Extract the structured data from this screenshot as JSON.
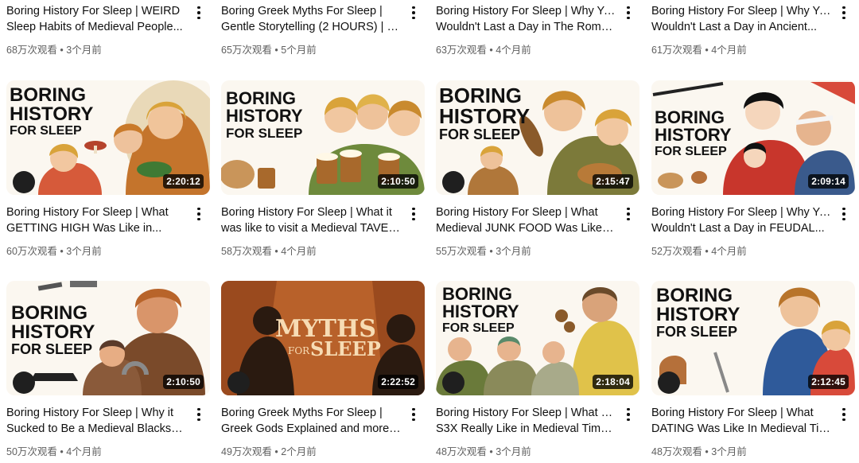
{
  "videos": [
    {
      "title_l1": "Boring History For Sleep | WEIRD",
      "title_l2": "Sleep Habits of Medieval People...",
      "views": "68万次观看",
      "age": "3个月前"
    },
    {
      "title_l1": "Boring Greek Myths For Sleep |",
      "title_l2": "Gentle Storytelling (2 HOURS) | 3...",
      "views": "65万次观看",
      "age": "5个月前"
    },
    {
      "title_l1": "Boring History For Sleep | Why You",
      "title_l2": "Wouldn't Last a Day in The Roman...",
      "views": "63万次观看",
      "age": "4个月前"
    },
    {
      "title_l1": "Boring History For Sleep | Why You",
      "title_l2": "Wouldn't Last a Day in Ancient...",
      "views": "61万次观看",
      "age": "4个月前"
    },
    {
      "title_l1": "Boring History For Sleep | What",
      "title_l2": "GETTING HIGH Was Like in...",
      "views": "60万次观看",
      "age": "3个月前",
      "duration": "2:20:12",
      "thumb_text": [
        "BORING",
        "HISTORY",
        "FOR SLEEP"
      ]
    },
    {
      "title_l1": "Boring History For Sleep | What it",
      "title_l2": "was like to visit a Medieval TAVER...",
      "views": "58万次观看",
      "age": "4个月前",
      "duration": "2:10:50",
      "thumb_text": [
        "BORING",
        "HISTORY",
        "FOR SLEEP"
      ]
    },
    {
      "title_l1": "Boring History For Sleep | What",
      "title_l2": "Medieval JUNK FOOD Was Like an...",
      "views": "55万次观看",
      "age": "3个月前",
      "duration": "2:15:47",
      "thumb_text": [
        "BORING",
        "HISTORY",
        "FOR SLEEP"
      ]
    },
    {
      "title_l1": "Boring History For Sleep | Why You",
      "title_l2": "Wouldn't Last a Day in FEUDAL...",
      "views": "52万次观看",
      "age": "4个月前",
      "duration": "2:09:14",
      "thumb_text": [
        "BORING",
        "HISTORY",
        "FOR SLEEP"
      ]
    },
    {
      "title_l1": "Boring History For Sleep | Why it",
      "title_l2": "Sucked to Be a Medieval Blacksmi...",
      "views": "50万次观看",
      "age": "4个月前",
      "duration": "2:10:50",
      "thumb_text": [
        "BORING",
        "HISTORY",
        "FOR SLEEP"
      ]
    },
    {
      "title_l1": "Boring Greek Myths For Sleep |",
      "title_l2": "Greek Gods Explained and more | ...",
      "views": "49万次观看",
      "age": "2个月前",
      "duration": "2:22:52",
      "thumb_text": [
        "MYTHS",
        "FOR",
        "SLEEP"
      ]
    },
    {
      "title_l1": "Boring History For Sleep | What Was",
      "title_l2": "S3X Really Like in Medieval Times...",
      "views": "48万次观看",
      "age": "3个月前",
      "duration": "2:18:04",
      "thumb_text": [
        "BORING",
        "HISTORY",
        "FOR SLEEP"
      ]
    },
    {
      "title_l1": "Boring History For Sleep | What",
      "title_l2": "DATING Was Like In Medieval Tim...",
      "views": "48万次观看",
      "age": "3个月前",
      "duration": "2:12:45",
      "thumb_text": [
        "BORING",
        "HISTORY",
        "FOR SLEEP"
      ]
    }
  ],
  "meta_separator": "•",
  "colors": {
    "duration_bg": "#000000",
    "meta_text": "#606060",
    "title_text": "#0f0f0f"
  },
  "icons": {
    "menu": "more-vert-icon",
    "channel_logo": "channel-logo-icon"
  }
}
